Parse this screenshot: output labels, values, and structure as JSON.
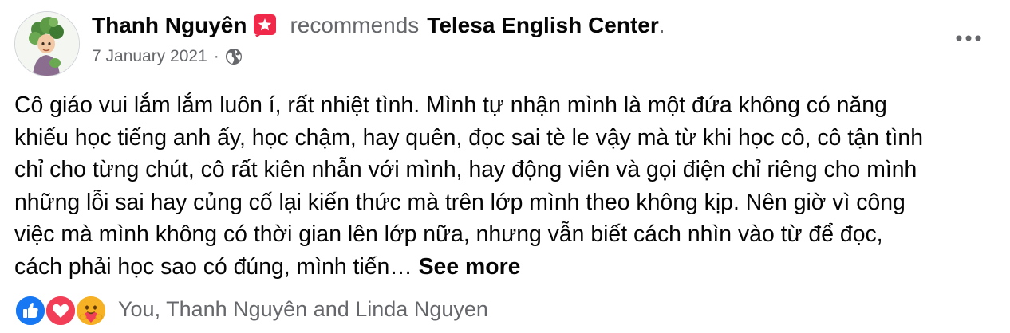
{
  "post": {
    "author": "Thanh Nguyên",
    "action": "recommends",
    "page": "Telesa English Center",
    "period": ".",
    "date": "7 January 2021",
    "separator": "·",
    "body": "Cô giáo vui lắm lắm luôn í, rất nhiệt tình. Mình tự nhận mình là một đứa không có năng\nkhiếu học tiếng anh ấy, học chậm, hay quên, đọc sai tè le vậy mà từ khi học cô, cô tận tình\nchỉ cho từng chút, cô rất kiên nhẫn với mình, hay động viên và gọi điện chỉ riêng cho mình\nnhững lỗi sai hay củng cố lại kiến thức mà trên lớp mình theo không kịp. Nên giờ vì công\nviệc mà mình không có thời gian lên lớp nữa, nhưng vẫn biết cách nhìn vào từ để đọc,\ncách phải học sao có đúng, mình tiến…",
    "see_more": "See more"
  },
  "reactions": {
    "icons": [
      "like-icon",
      "love-icon",
      "care-icon"
    ],
    "summary": "You, Thanh Nguyên and Linda Nguyen"
  },
  "icons": {
    "badge": "star-badge-icon",
    "privacy": "globe-icon",
    "menu": "more-options-icon"
  },
  "colors": {
    "primary_text": "#050505",
    "secondary_text": "#65676b",
    "badge": "#f02849",
    "like": "#1877f2",
    "love": "#f33e58",
    "care": "#f7b125"
  }
}
